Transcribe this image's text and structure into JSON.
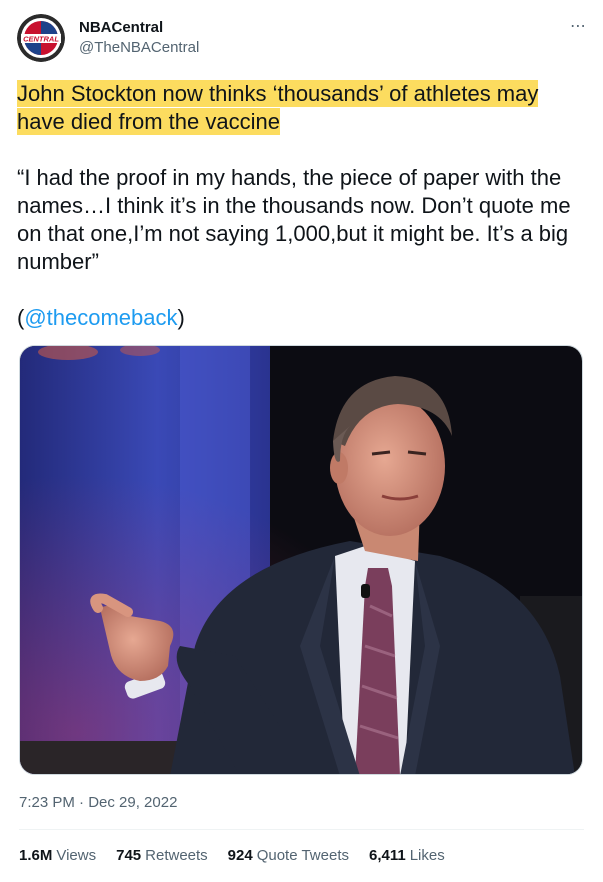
{
  "author": {
    "display_name": "NBACentral",
    "handle": "@TheNBACentral",
    "avatar_text": "CENTRAL",
    "avatar_colors": {
      "ring": "#2b2b2b",
      "red": "#c8102e",
      "blue": "#1d428a"
    }
  },
  "more_icon": "⋯",
  "tweet": {
    "headline": "John Stockton now thinks ‘thousands’ of athletes may have died from the vaccine",
    "quote": "“I had the proof in my hands, the piece of paper with the names…I think it’s in the thousands now. Don’t quote me on that one,I’m not saying 1,000,but it might be. It’s a big number”",
    "source_open": "(",
    "source_mention": "@thecomeback",
    "source_close": ")",
    "highlight_color": "#fcdc5f"
  },
  "media": {
    "background_colors": {
      "left_blue": "#3b4fb8",
      "right_dark": "#0d0d12",
      "suit": "#1f2430",
      "shirt": "#e8e9ee",
      "tie": "#7a3e5c"
    }
  },
  "timestamp": "7:23 PM · Dec 29, 2022",
  "stats": [
    {
      "value": "1.6M",
      "label": "Views"
    },
    {
      "value": "745",
      "label": "Retweets"
    },
    {
      "value": "924",
      "label": "Quote Tweets"
    },
    {
      "value": "6,411",
      "label": "Likes"
    }
  ]
}
